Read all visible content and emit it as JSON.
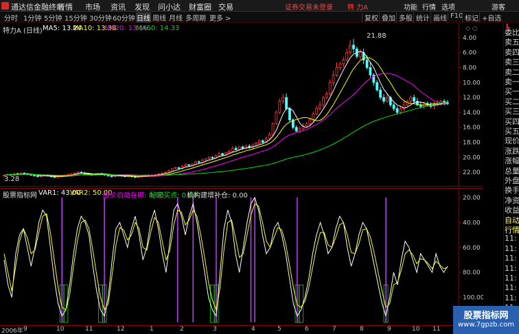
{
  "titlebar": {
    "app_name": "通达信金融终端",
    "menus": [
      "行情",
      "市场",
      "资讯",
      "发现",
      "问小达",
      "财富圈",
      "交易"
    ],
    "warning": "证券交易未登录",
    "stock": "特 力A",
    "right_menus": [
      "功能",
      "行情",
      "选项"
    ],
    "guest": "游客"
  },
  "toolbar": {
    "periods": [
      "分时",
      "1分钟",
      "5分钟",
      "15分钟",
      "30分钟",
      "60分钟",
      "日线",
      "周线",
      "月线",
      "多周期",
      "更多 >"
    ],
    "active_period": "日线",
    "tools": [
      "复权",
      "叠加",
      "多股",
      "统计",
      "画线",
      "F10",
      "标记",
      "+自选"
    ]
  },
  "main_legend": {
    "name": "特力A (日线)",
    "ma5": "MA5: 13.24",
    "ma10": "MA10: 13.38",
    "ma20": "MA20: 13.16",
    "ma60": "MA60: 14.33"
  },
  "colors": {
    "up": "#ff3c3c",
    "down": "#54fcfc",
    "ma5": "#ffffff",
    "ma10": "#ffff00",
    "ma20": "#ff00ff",
    "ma60": "#00e000",
    "axis_red": "#8a0000"
  },
  "main_axis": {
    "ticks": [
      "22.00",
      "20.00",
      "18.00",
      "16.00",
      "14.00",
      "12.00",
      "10.00",
      "8.00",
      "6.00",
      "4.00"
    ],
    "high_label": "21.88",
    "low_label": "3.28"
  },
  "ind_legend": {
    "name": "股票指标网",
    "var1": "VAR1: 43.00",
    "var2": "VAR2: 50.00",
    "s1": "股价启动在即: 0.00",
    "s2": "秘密买点: 0.00",
    "s3": "机构建增补仓: 0.00"
  },
  "ind_axis": {
    "ticks": [
      "100.00",
      "80.00",
      "60.00",
      "40.00",
      "20.00"
    ]
  },
  "right_panel": {
    "rows": [
      "委比",
      "卖五",
      "卖四",
      "卖三",
      "卖二",
      "卖一",
      "买一",
      "买二",
      "买三",
      "买四",
      "买五",
      "现价",
      "涨跌",
      "涨幅",
      "总量",
      "外盘",
      "换手",
      "净资",
      "收益",
      "自动",
      "行情",
      "11:",
      "11:",
      "11:",
      "11:",
      "11:",
      "11:",
      "11:",
      "11:",
      "11:"
    ]
  },
  "date_axis": {
    "labels": [
      "2006年",
      "9",
      "10",
      "11",
      "12",
      "1",
      "2",
      "3",
      "4",
      "5",
      "6",
      "7",
      "8",
      "9",
      "10",
      "11"
    ]
  },
  "watermark": {
    "line1": "股票指标网",
    "line2": "www.7gpzb.com"
  },
  "chart_data": [
    {
      "type": "candlestick",
      "y_range": [
        3,
        23
      ],
      "ticks": [
        4,
        6,
        8,
        10,
        12,
        14,
        16,
        18,
        20,
        22
      ],
      "max_label": 21.88,
      "min_label": 3.28,
      "closes": [
        3.6,
        3.7,
        3.6,
        3.8,
        3.7,
        3.9,
        3.8,
        3.7,
        3.6,
        3.5,
        3.4,
        3.5,
        3.6,
        3.5,
        3.4,
        3.3,
        3.4,
        3.5,
        3.6,
        3.7,
        3.8,
        3.9,
        4.0,
        3.9,
        3.8,
        3.7,
        3.6,
        3.7,
        3.8,
        3.7,
        3.6,
        3.5,
        3.4,
        3.5,
        3.6,
        3.5,
        3.4,
        3.5,
        3.4,
        3.3,
        3.4,
        3.5,
        3.6,
        3.5,
        3.6,
        3.7,
        3.8,
        3.9,
        4.0,
        4.2,
        4.5,
        4.6,
        4.5,
        4.8,
        5.0,
        4.9,
        5.1,
        5.4,
        5.3,
        5.6,
        5.8,
        6.0,
        5.9,
        6.2,
        6.5,
        6.3,
        6.6,
        6.8,
        7.2,
        7.0,
        7.4,
        7.2,
        7.5,
        7.3,
        7.6,
        7.9,
        8.2,
        8.0,
        8.5,
        9.0,
        10.5,
        12.0,
        13.5,
        14.0,
        12.5,
        11.0,
        10.0,
        9.5,
        9.8,
        10.2,
        10.5,
        11.0,
        11.8,
        12.5,
        13.0,
        14.0,
        14.5,
        16.0,
        17.0,
        18.0,
        18.5,
        19.0,
        20.0,
        21.0,
        20.5,
        19.5,
        20.0,
        19.0,
        18.0,
        17.0,
        16.0,
        15.0,
        14.0,
        13.5,
        14.0,
        13.0,
        12.5,
        12.0,
        12.5,
        13.0,
        13.5,
        14.0,
        13.5,
        13.0,
        12.8,
        13.2,
        13.0,
        12.8,
        13.0,
        13.2,
        13.5,
        13.3,
        13.2
      ]
    },
    {
      "type": "line",
      "y_range": [
        0,
        100
      ],
      "ticks": [
        20,
        40,
        60,
        80,
        100
      ],
      "series": [
        {
          "name": "VAR1",
          "values": [
            50,
            30,
            20,
            55,
            70,
            75,
            60,
            45,
            60,
            80,
            90,
            85,
            60,
            35,
            15,
            5,
            10,
            30,
            55,
            75,
            85,
            80,
            70,
            45,
            25,
            10,
            5,
            20,
            50,
            75,
            80,
            70,
            60,
            75,
            85,
            70,
            50,
            60,
            80,
            90,
            75,
            55,
            40,
            65,
            90,
            95,
            85,
            70,
            85,
            95,
            80,
            60,
            40,
            20,
            10,
            5,
            40,
            75,
            90,
            80,
            55,
            40,
            60,
            80,
            95,
            100,
            90,
            70,
            55,
            60,
            75,
            80,
            70,
            55,
            35,
            15,
            5,
            10,
            20,
            35,
            55,
            70,
            80,
            70,
            55,
            60,
            75,
            85,
            80,
            60,
            45,
            55,
            70,
            80,
            75,
            60,
            45,
            30,
            15,
            5,
            20,
            40,
            30,
            50,
            65,
            60,
            50,
            40,
            55,
            50,
            45,
            40,
            55,
            45,
            40,
            45
          ]
        },
        {
          "name": "VAR2",
          "values": [
            55,
            40,
            25,
            45,
            65,
            75,
            68,
            55,
            58,
            72,
            85,
            87,
            72,
            50,
            28,
            12,
            10,
            22,
            45,
            65,
            80,
            82,
            75,
            58,
            38,
            20,
            10,
            15,
            38,
            62,
            76,
            74,
            66,
            70,
            80,
            75,
            60,
            58,
            72,
            84,
            80,
            65,
            50,
            58,
            78,
            90,
            88,
            78,
            82,
            90,
            85,
            70,
            52,
            32,
            18,
            10,
            28,
            58,
            80,
            82,
            68,
            52,
            55,
            70,
            86,
            95,
            93,
            80,
            65,
            60,
            68,
            76,
            74,
            63,
            46,
            28,
            14,
            12,
            17,
            28,
            44,
            60,
            72,
            72,
            62,
            60,
            68,
            78,
            80,
            70,
            56,
            55,
            63,
            74,
            75,
            68,
            55,
            40,
            25,
            12,
            15,
            30,
            32,
            42,
            55,
            58,
            54,
            47,
            51,
            50,
            47,
            43,
            49,
            46,
            43,
            44
          ]
        }
      ]
    }
  ]
}
